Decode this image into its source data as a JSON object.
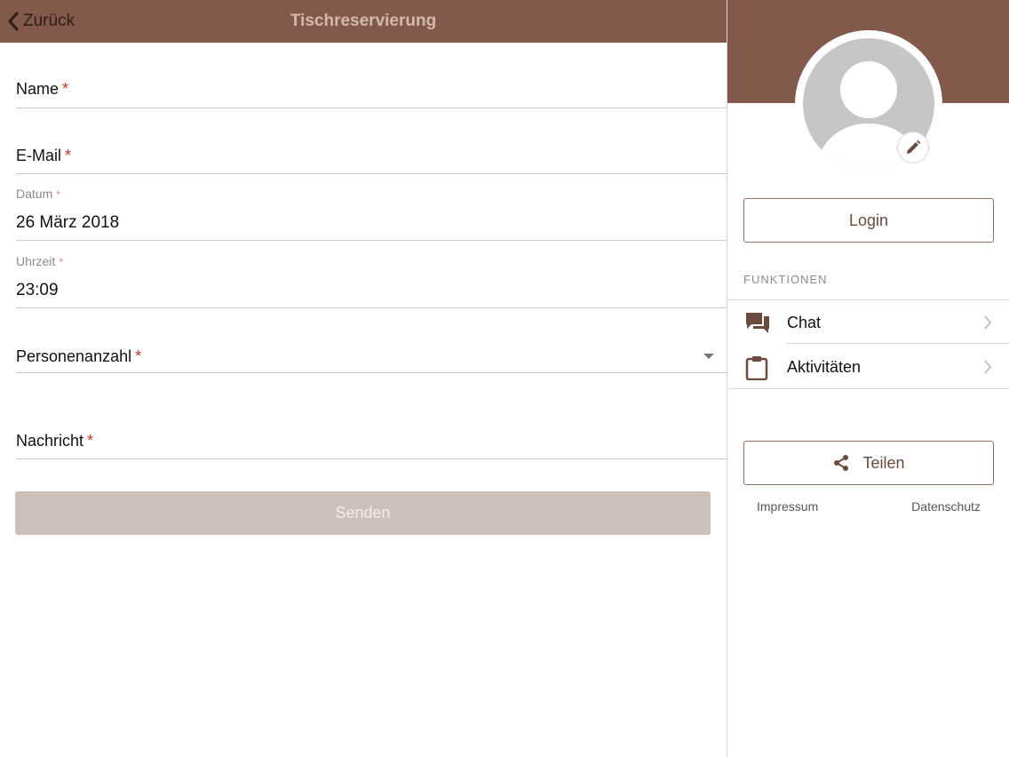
{
  "header": {
    "back_label": "Zurück",
    "title": "Tischreservierung"
  },
  "form": {
    "name_label": "Name",
    "email_label": "E-Mail",
    "date_label": "Datum",
    "date_value": "26 März 2018",
    "time_label": "Uhrzeit",
    "time_value": "23:09",
    "persons_label": "Personenanzahl",
    "message_label": "Nachricht",
    "required_mark": "*",
    "submit_label": "Senden"
  },
  "sidebar": {
    "login_label": "Login",
    "section_title": "FUNKTIONEN",
    "items": [
      {
        "label": "Chat",
        "icon": "chat-icon"
      },
      {
        "label": "Aktivitäten",
        "icon": "clipboard-icon"
      }
    ],
    "share_label": "Teilen",
    "footer_links": [
      "Impressum",
      "Datenschutz"
    ]
  },
  "colors": {
    "brand": "#82594b",
    "submit_disabled": "#cdc0ba",
    "required": "#d0312d"
  }
}
